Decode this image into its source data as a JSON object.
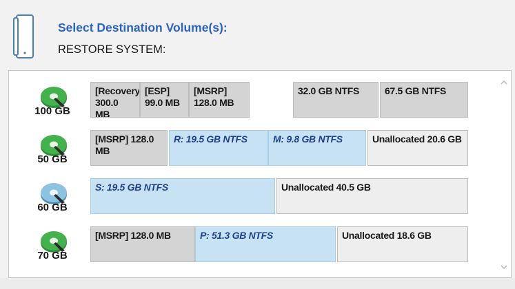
{
  "header": {
    "title": "Select Destination Volume(s):",
    "subtitle": "RESTORE SYSTEM:"
  },
  "icons": {
    "device": "portable-device-icon",
    "disk": "hard-disk-icon",
    "scroll_up": "chevron-up-icon",
    "scroll_down": "chevron-down-icon"
  },
  "colors": {
    "title": "#2b63c6",
    "partition_gray": "#d4d4d4",
    "partition_light": "#eeeeee",
    "partition_selected": "#c7e3f3",
    "disk_green": "#3fae49",
    "disk_blue": "#7fb8d8"
  },
  "disks": [
    {
      "size": "100 GB",
      "icon_color": "green",
      "partitions": [
        {
          "label": "[Recovery] 300.0 MB",
          "style": "gray"
        },
        {
          "label": "[ESP] 99.0 MB",
          "style": "gray"
        },
        {
          "label": "[MSRP] 128.0 MB",
          "style": "gray"
        },
        {
          "label": "32.0 GB NTFS",
          "style": "gray"
        },
        {
          "label": "67.5 GB NTFS",
          "style": "gray"
        }
      ]
    },
    {
      "size": "50 GB",
      "icon_color": "green",
      "partitions": [
        {
          "label": "[MSRP] 128.0 MB",
          "style": "gray"
        },
        {
          "label": "R: 19.5 GB NTFS",
          "style": "blue"
        },
        {
          "label": "M: 9.8 GB NTFS",
          "style": "blue"
        },
        {
          "label": "Unallocated 20.6 GB",
          "style": "light"
        }
      ]
    },
    {
      "size": "60 GB",
      "icon_color": "blue",
      "partitions": [
        {
          "label": "S: 19.5 GB NTFS",
          "style": "blue"
        },
        {
          "label": "Unallocated 40.5 GB",
          "style": "light"
        }
      ]
    },
    {
      "size": "70 GB",
      "icon_color": "green",
      "partitions": [
        {
          "label": "[MSRP] 128.0 MB",
          "style": "gray"
        },
        {
          "label": "P: 51.3 GB NTFS",
          "style": "blue"
        },
        {
          "label": "Unallocated 18.6 GB",
          "style": "light"
        }
      ]
    }
  ]
}
